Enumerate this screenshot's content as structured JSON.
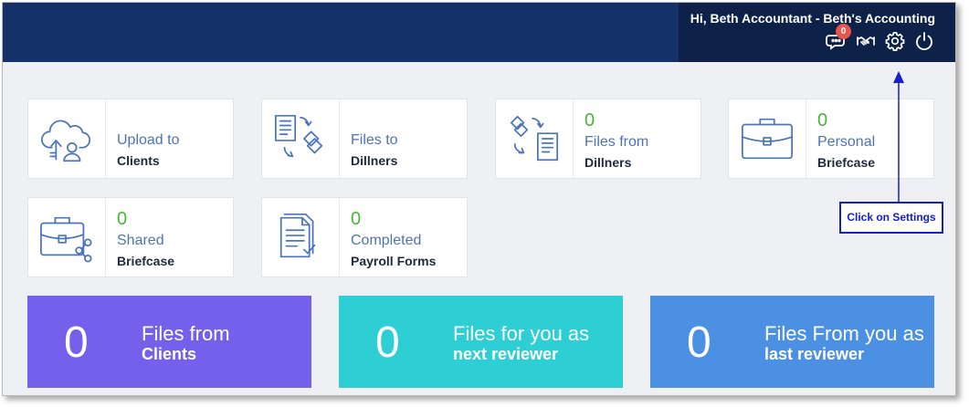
{
  "header": {
    "greeting": "Hi, Beth Accountant - Beth's Accounting",
    "notifications_count": "0",
    "icons": [
      "chat-icon",
      "handshake-icon",
      "gear-icon",
      "power-icon"
    ]
  },
  "tiles": [
    {
      "label1": "Upload to",
      "label2": "Clients",
      "icon": "cloud-upload-icon"
    },
    {
      "label1": "Files to",
      "label2": "Dillners",
      "icon": "files-to-icon"
    },
    {
      "count": "0",
      "label1": "Files from",
      "label2": "Dillners",
      "icon": "files-from-icon"
    },
    {
      "count": "0",
      "label1": "Personal",
      "label2": "Briefcase",
      "icon": "briefcase-icon"
    },
    {
      "count": "0",
      "label1": "Shared",
      "label2": "Briefcase",
      "icon": "shared-briefcase-icon"
    },
    {
      "count": "0",
      "label1": "Completed",
      "label2": "Payroll Forms",
      "icon": "payroll-forms-icon"
    }
  ],
  "cards": [
    {
      "count": "0",
      "label1": "Files from",
      "label2": "Clients",
      "color": "#7460ea"
    },
    {
      "count": "0",
      "label1": "Files for you as",
      "label2": "next reviewer",
      "color": "#2dcfd4"
    },
    {
      "count": "0",
      "label1": "Files From you as",
      "label2": "last reviewer",
      "color": "#4b90e2"
    }
  ],
  "annotation": {
    "text": "Click on Settings",
    "color": "#1420c8"
  },
  "colors": {
    "header_bg": "#143269",
    "user_panel_bg": "#0d2149",
    "count_green": "#4ab33a",
    "label_blue": "#4e73b4",
    "icon_blue": "#4a74bb"
  }
}
